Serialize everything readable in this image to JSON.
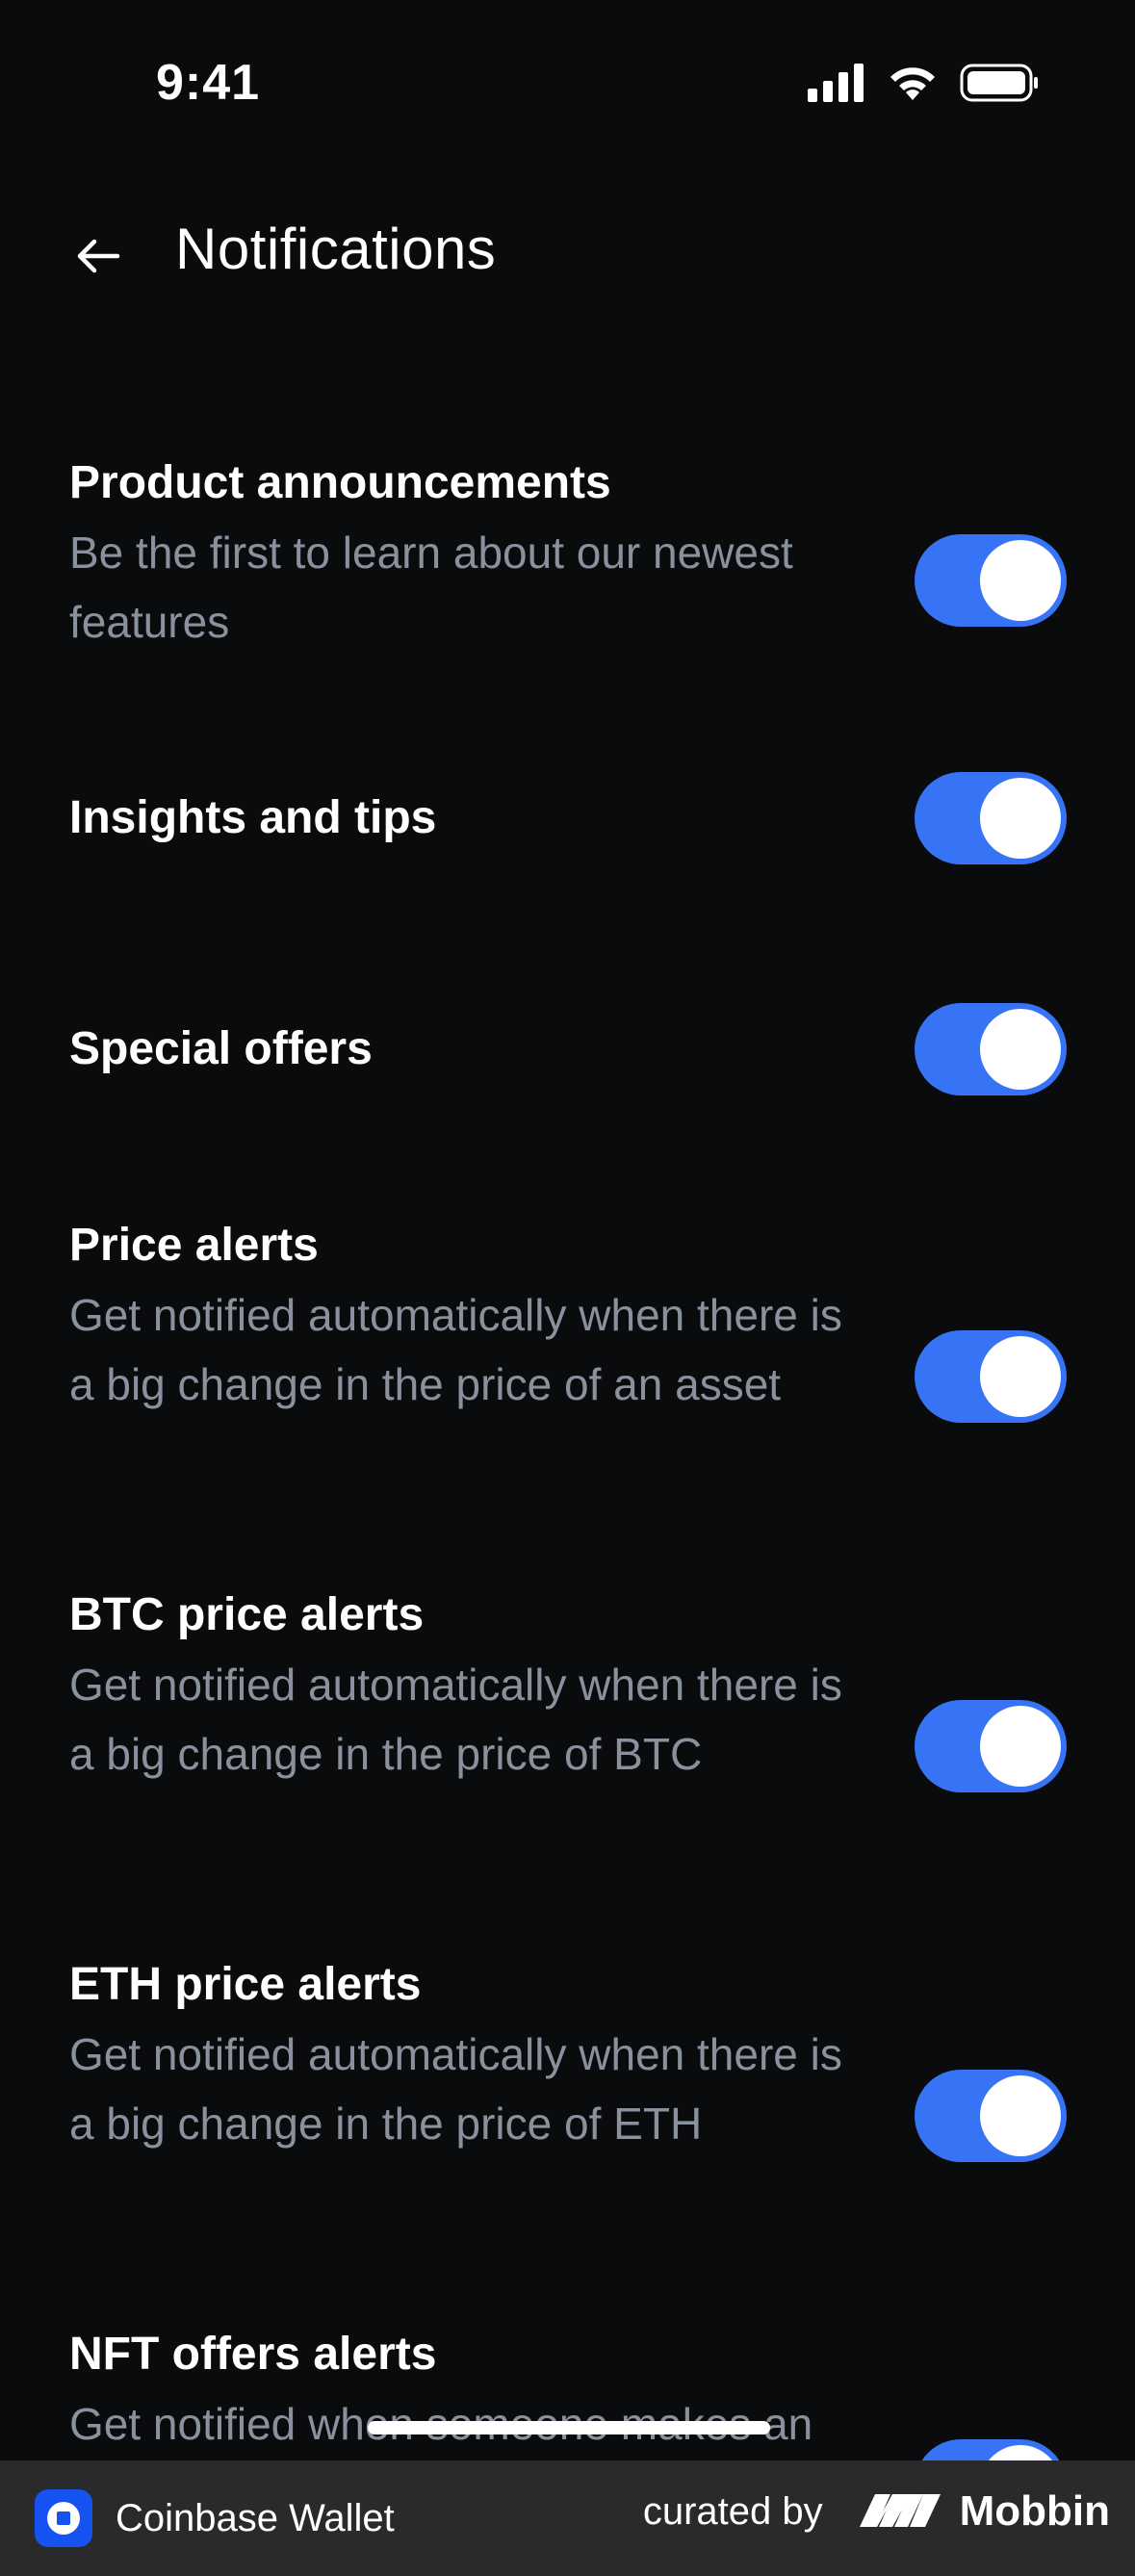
{
  "status_bar": {
    "time": "9:41"
  },
  "header": {
    "title": "Notifications"
  },
  "settings": [
    {
      "title": "Product announcements",
      "description": "Be the first to learn about our newest features",
      "enabled": true
    },
    {
      "title": "Insights and tips",
      "description": "",
      "enabled": true
    },
    {
      "title": "Special offers",
      "description": "",
      "enabled": true
    },
    {
      "title": "Price alerts",
      "description": "Get notified automatically when there is a big change in the price of an asset",
      "enabled": true
    },
    {
      "title": "BTC price alerts",
      "description": "Get notified automatically when there is a big change in the price of BTC",
      "enabled": true
    },
    {
      "title": "ETH price alerts",
      "description": "Get notified automatically when there is a big change in the price of ETH",
      "enabled": true
    },
    {
      "title": "NFT offers alerts",
      "description": "Get notified when someone makes an",
      "enabled": true
    }
  ],
  "footer": {
    "brand": "Coinbase Wallet",
    "curated_label": "curated by",
    "curator": "Mobbin"
  },
  "colors": {
    "background": "#0a0b0d",
    "toggle_on": "#3773f5",
    "secondary_text": "#8a919e",
    "footer_bg": "#2a2a2c"
  },
  "icons": {
    "back": "arrow-left-icon",
    "signal": "cellular-signal-icon",
    "wifi": "wifi-icon",
    "battery": "battery-icon"
  }
}
